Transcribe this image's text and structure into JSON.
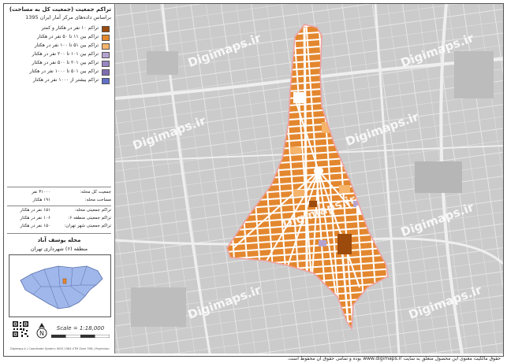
{
  "legend": {
    "title": "تراکم جمعیت (جمعیت کل به مساحت)",
    "subtitle": "براساس داده‌های مرکز آمار ایران 1395",
    "items": [
      {
        "label": "تراکم ۱۰ نفر در هکتار و کمتر",
        "color": "#9c4b0c"
      },
      {
        "label": "تراکم بین ۱۱ تا ۵۰ نفر در هکتار",
        "color": "#e3872f"
      },
      {
        "label": "تراکم بین ۵۱ تا ۱۰۰ نفر در هکتار",
        "color": "#f5b46a"
      },
      {
        "label": "تراکم بین ۱۰۱ تا ۲۰۰ نفر در هکتار",
        "color": "#b5a3cf"
      },
      {
        "label": "تراکم بین ۲۰۱ تا ۵۰۰ نفر در هکتار",
        "color": "#9886c0"
      },
      {
        "label": "تراکم بین ۵۰۱ تا ۱۰۰۰ نفر در هکتار",
        "color": "#7f6db3"
      },
      {
        "label": "تراکم بیشتر از ۱۰۰۰ نفر در هکتار",
        "color": "#6170c6"
      }
    ]
  },
  "stats": [
    {
      "label": "جمعیت کل محله:",
      "value": "۳۱۰۰۰ نفر"
    },
    {
      "label": "مساحت محله:",
      "value": "۱۹۱ هکتار"
    },
    {
      "label": "تراکم جمعیتی محله:",
      "value": "۱۵۱ نفر در هکتار"
    },
    {
      "label": "تراکم جمعیتی منطقه ۶:",
      "value": "۱۰۶ نفر در هکتار"
    },
    {
      "label": "تراکم جمعیتی شهر تهران:",
      "value": "۱۵۰ نفر در هکتار"
    }
  ],
  "place": {
    "neighborhood": "محله یوسف آباد",
    "district": "منطقه (۶) شهرداری تهران"
  },
  "scale": "Scale = 1:18,000",
  "watermark": "Digimaps.ir",
  "footer": "حقوق مالکیت معنوی این محصول متعلق به سایت www.digimaps.ir بوده و تمامی حقوق آن محفوظ است.",
  "fine_print": "Digimaps.ir | Coordinate System: WGS 1984 UTM Zone 39N | Projection: Transverse Mercator",
  "colors": {
    "map_bg": "#cfcfcf",
    "district_fill": "#e3872f",
    "district_outline": "#f0a0a0",
    "street": "#f4f4f4",
    "inset_city": "#9fb7ea"
  },
  "north_label": "N"
}
